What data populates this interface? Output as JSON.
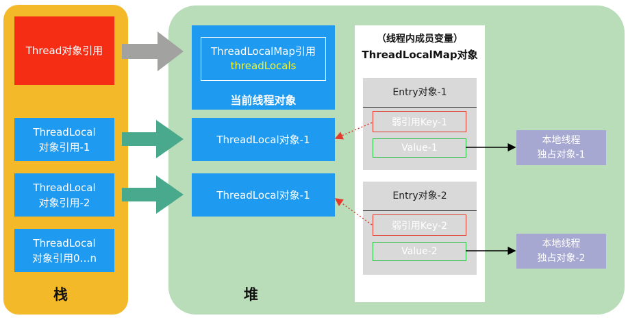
{
  "stack": {
    "label": "栈",
    "items": [
      {
        "text": "Thread对象引用"
      },
      {
        "text": "ThreadLocal\n对象引用-1"
      },
      {
        "text": "ThreadLocal\n对象引用-2"
      },
      {
        "text": "ThreadLocal\n对象引用0…n"
      }
    ]
  },
  "heap": {
    "label": "堆",
    "thread_object": {
      "map_ref": "ThreadLocalMap引用",
      "field": "threadLocals",
      "caption": "当前线程对象"
    },
    "threadlocal_objects": [
      {
        "text": "ThreadLocal对象-1"
      },
      {
        "text": "ThreadLocal对象-1"
      }
    ],
    "map": {
      "subtitle": "（线程内成员变量）",
      "title": "ThreadLocalMap对象",
      "entries": [
        {
          "title": "Entry对象-1",
          "key": "弱引用Key-1",
          "value": "Value-1"
        },
        {
          "title": "Entry对象-2",
          "key": "弱引用Key-2",
          "value": "Value-2"
        }
      ]
    },
    "local_objects": [
      {
        "text": "本地线程\n独占对象-1"
      },
      {
        "text": "本地线程\n独占对象-2"
      }
    ]
  },
  "colors": {
    "stack_bg": "#f4b928",
    "heap_bg": "#b9dcb9",
    "blue": "#1e9bf0",
    "red": "#f52d14",
    "field_yellow": "#f7f52a",
    "weak_ref_red": "#e23b2e",
    "value_green": "#2bbf44",
    "local_purple": "#a6a8d2",
    "gray_arrow": "#a2a3a0",
    "teal_arrow": "#48a98d"
  }
}
